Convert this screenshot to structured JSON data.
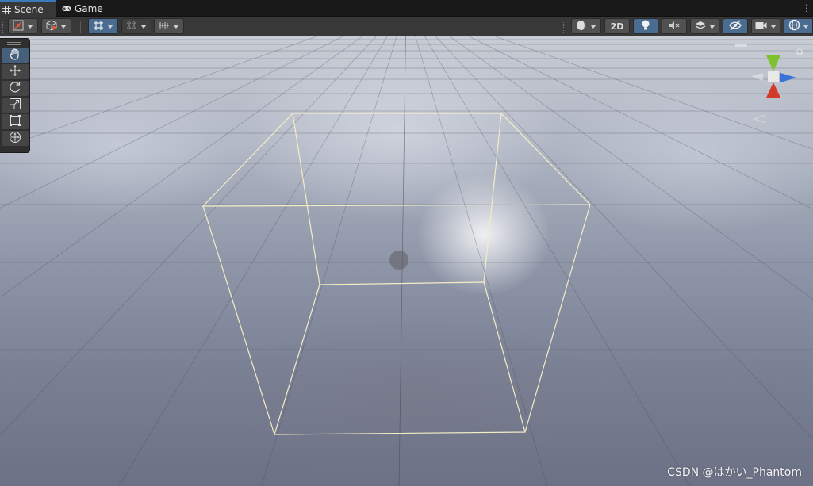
{
  "tabs": [
    {
      "label": "Scene",
      "icon": "grid-icon"
    },
    {
      "label": "Game",
      "icon": "gamepad-icon"
    }
  ],
  "toolbar": {
    "mode_2d_label": "2D"
  },
  "tools": [
    "hand-tool",
    "move-tool",
    "rotate-tool",
    "scale-tool",
    "rect-tool",
    "transform-tool"
  ],
  "active_tool": "hand-tool",
  "gizmo": {
    "x_color": "#d43a2a",
    "y_color": "#7ec22f",
    "z_color": "#3a72d8"
  },
  "watermark": "CSDN @はかい_Phantom",
  "colors": {
    "accent": "#3a79bb",
    "active_button": "#4b6c91",
    "bounds_line": "#f3edc4"
  }
}
